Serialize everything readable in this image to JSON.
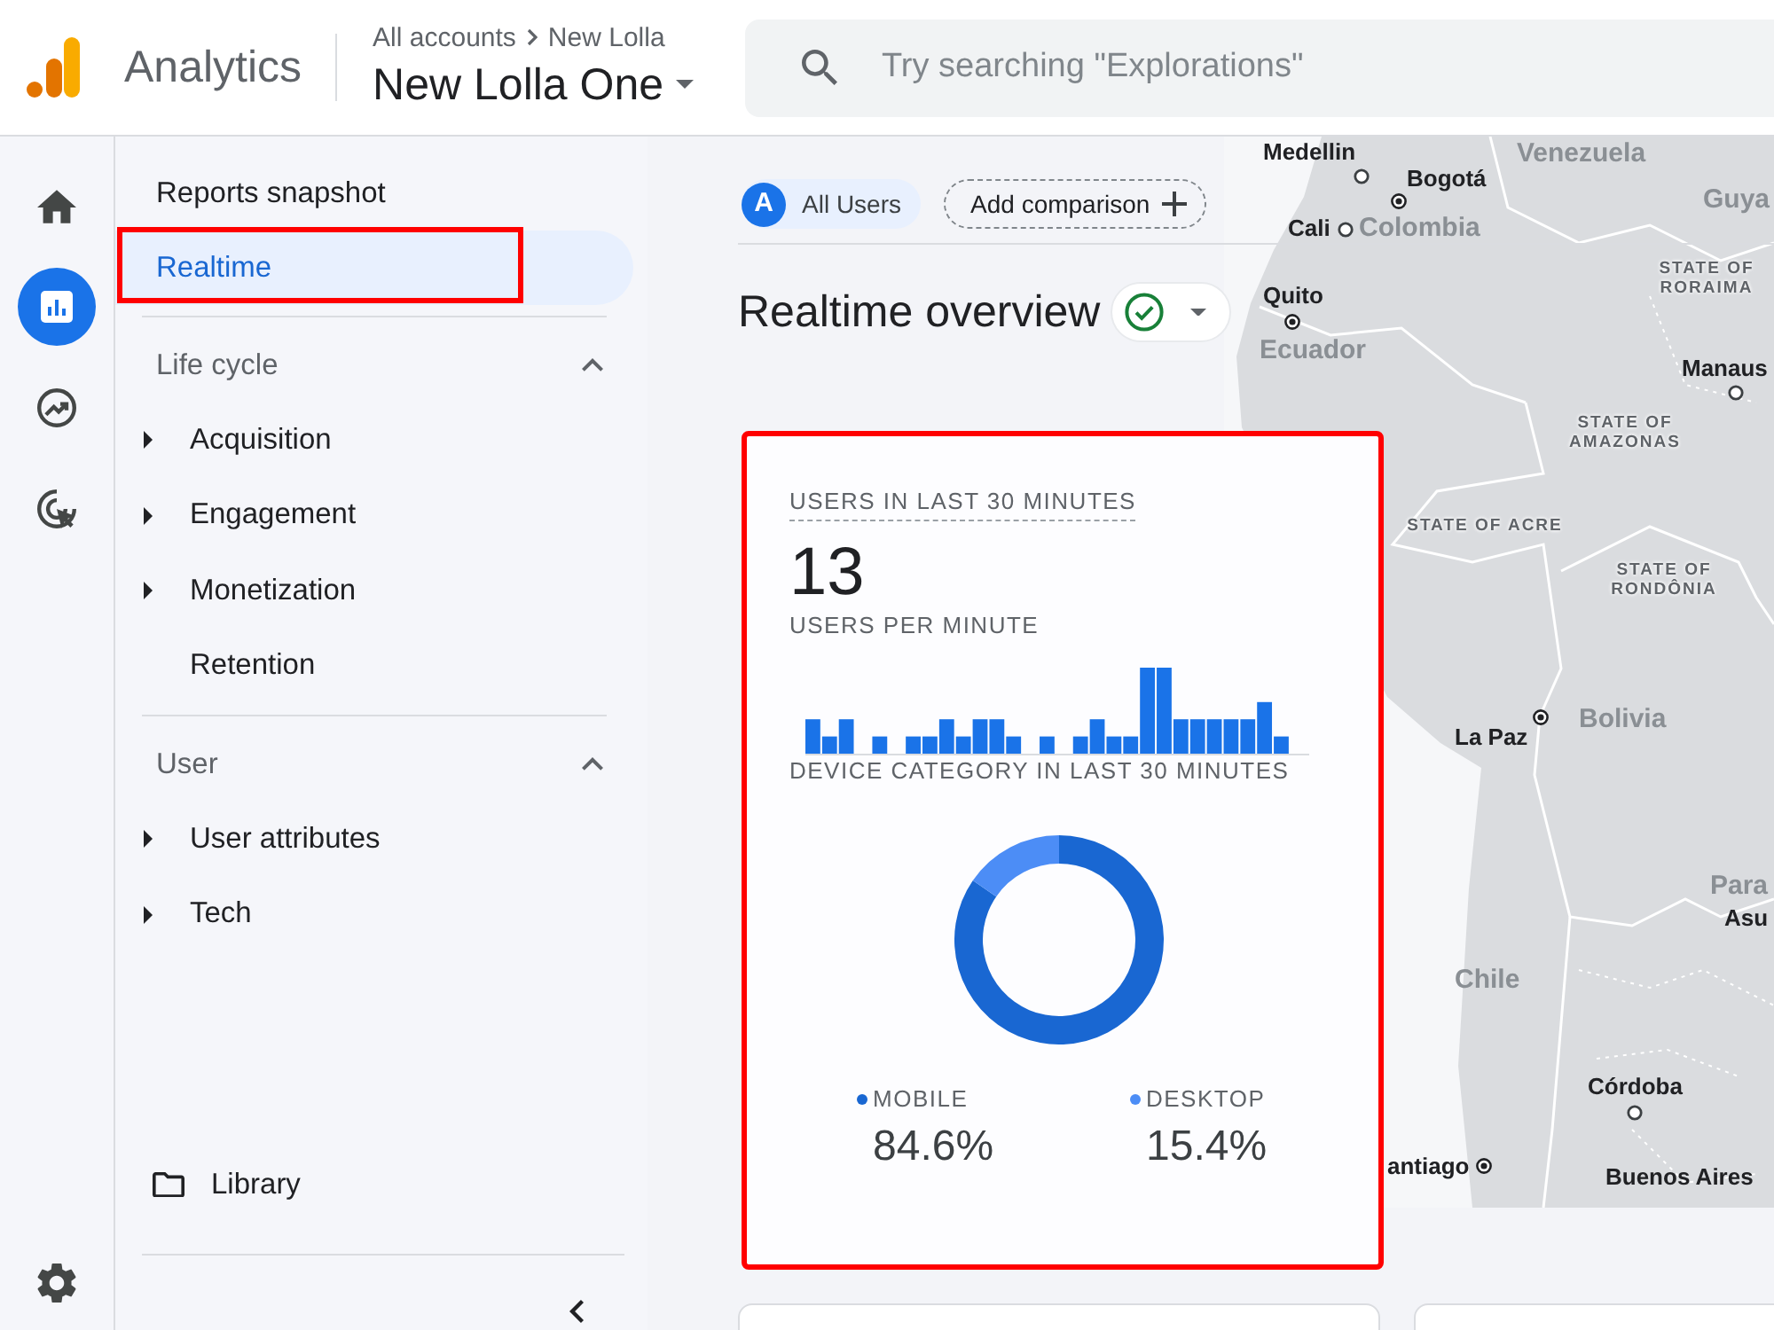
{
  "header": {
    "app_name": "Analytics",
    "breadcrumb": [
      "All accounts",
      "New Lolla"
    ],
    "property": "New Lolla One",
    "search": {
      "placeholder": "Try searching \"Explorations\""
    }
  },
  "rail": {
    "items": [
      {
        "kind": "home",
        "selected": false
      },
      {
        "kind": "reports",
        "selected": true
      },
      {
        "kind": "explore",
        "selected": false
      },
      {
        "kind": "advertising",
        "selected": false
      }
    ]
  },
  "sidebar": {
    "items": [
      {
        "label": "Reports snapshot",
        "selected": false,
        "highlighted": false
      },
      {
        "label": "Realtime",
        "selected": true,
        "highlighted": true
      }
    ],
    "sections": [
      {
        "title": "Life cycle",
        "expanded": true,
        "items": [
          {
            "label": "Acquisition",
            "expandable": true,
            "selected": false
          },
          {
            "label": "Engagement",
            "expandable": true,
            "selected": false
          },
          {
            "label": "Monetization",
            "expandable": true,
            "selected": false
          },
          {
            "label": "Retention",
            "expandable": false,
            "selected": false
          }
        ]
      },
      {
        "title": "User",
        "expanded": true,
        "items": [
          {
            "label": "User attributes",
            "expandable": true,
            "selected": false
          },
          {
            "label": "Tech",
            "expandable": true,
            "selected": false
          }
        ]
      }
    ],
    "library": "Library"
  },
  "comparisons": {
    "segments": [
      {
        "badge": "A",
        "label": "All Users"
      }
    ],
    "add_button": "Add comparison"
  },
  "page_title": "Realtime overview",
  "users_card": {
    "highlighted": true,
    "users_title": "USERS IN LAST 30 MINUTES",
    "users_count": "13",
    "per_minute_title": "USERS PER MINUTE",
    "device_category": {
      "title": "DEVICE CATEGORY IN LAST 30 MINUTES",
      "chart_data": {
        "type": "donut",
        "categories": [
          "MOBILE",
          "DESKTOP"
        ],
        "values": [
          84.6,
          15.4
        ],
        "colors": [
          "#1967d2",
          "#4c8df6"
        ],
        "value_labels": [
          "84.6%",
          "15.4%"
        ]
      }
    }
  },
  "map": {
    "labels": [
      {
        "kind": "city",
        "text": "Medellin"
      },
      {
        "kind": "country",
        "text": "Venezuela"
      },
      {
        "kind": "capital",
        "text": "Bogotá"
      },
      {
        "kind": "country",
        "text": "Guya"
      },
      {
        "kind": "city",
        "text": "Cali"
      },
      {
        "kind": "country",
        "text": "Colombia"
      },
      {
        "kind": "region",
        "text": "STATE OF RORAIMA"
      },
      {
        "kind": "capital",
        "text": "Quito"
      },
      {
        "kind": "country",
        "text": "Ecuador"
      },
      {
        "kind": "city",
        "text": "Manaus"
      },
      {
        "kind": "region",
        "text": "STATE OF AMAZONAS"
      },
      {
        "kind": "region",
        "text": "STATE OF ACRE"
      },
      {
        "kind": "region",
        "text": "STATE OF RONDÔNIA"
      },
      {
        "kind": "country",
        "text": "Bolivia"
      },
      {
        "kind": "capital",
        "text": "La Paz"
      },
      {
        "kind": "country",
        "text": "Para"
      },
      {
        "kind": "place",
        "text": "Asu"
      },
      {
        "kind": "country",
        "text": "Chile"
      },
      {
        "kind": "city",
        "text": "Córdoba"
      },
      {
        "kind": "capital",
        "text": "antiago"
      },
      {
        "kind": "place",
        "text": "Buenos Aires"
      }
    ]
  }
}
